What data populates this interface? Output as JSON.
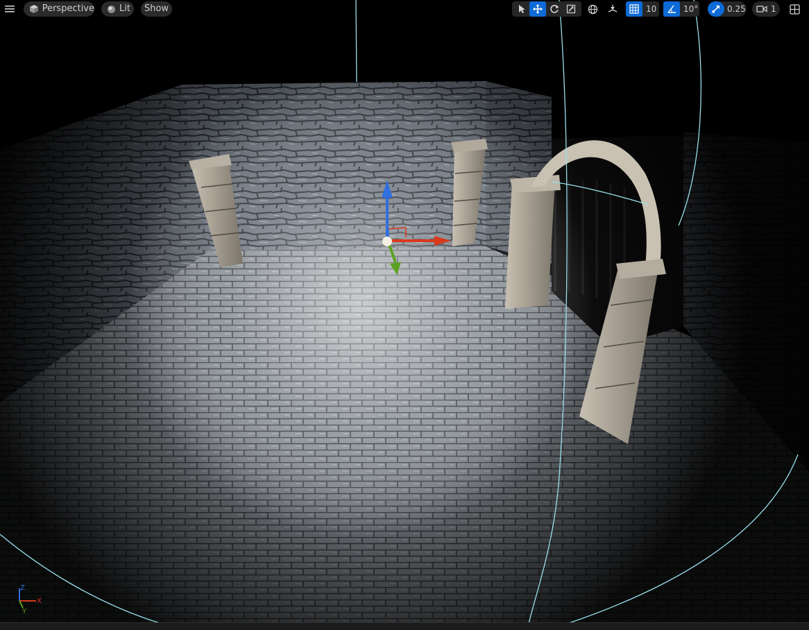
{
  "toolbar": {
    "menu_icon": "hamburger-menu-icon",
    "view_mode": "Perspective",
    "lighting_mode": "Lit",
    "show_label": "Show",
    "grid_snap_value": "10",
    "rotation_snap_value": "10°",
    "scale_snap_value": "0.25",
    "camera_speed_value": "1"
  },
  "axis_indicator": {
    "z": "Z",
    "x": "X",
    "y": "Y"
  },
  "colors": {
    "accent": "#0e6ad6",
    "gizmo_z": "#2f6fe0",
    "gizmo_x": "#d83a1c",
    "gizmo_y": "#5aa21e",
    "light_radius": "#9ae0ee"
  }
}
